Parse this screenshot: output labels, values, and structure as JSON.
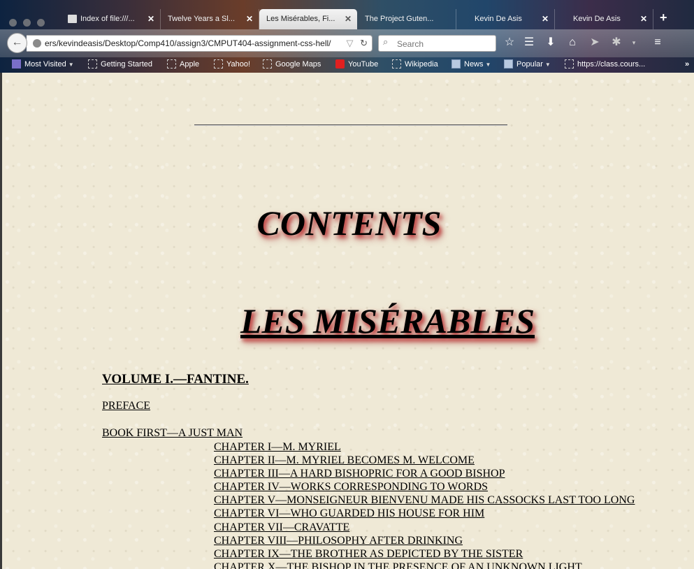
{
  "browser": {
    "tabs": [
      {
        "title": "Index of file:///...",
        "active": false
      },
      {
        "title": "Twelve Years a Sl...",
        "active": false
      },
      {
        "title": "Les Misérables, Fi...",
        "active": true
      },
      {
        "title": "The Project Guten...",
        "active": false
      },
      {
        "title": "Kevin De Asis",
        "active": false
      },
      {
        "title": "Kevin De Asis",
        "active": false
      }
    ],
    "url": "ers/kevindeasis/Desktop/Comp410/assign3/CMPUT404-assignment-css-hell/",
    "search_placeholder": "Search",
    "bookmarks": [
      "Most Visited",
      "Getting Started",
      "Apple",
      "Yahoo!",
      "Google Maps",
      "YouTube",
      "Wikipedia",
      "News",
      "Popular",
      "https://class.cours..."
    ]
  },
  "page": {
    "heading": "CONTENTS",
    "title": "LES MISÉRABLES",
    "volume": "VOLUME I.—FANTINE.",
    "preface": "PREFACE",
    "book": "BOOK FIRST—A JUST MAN",
    "chapters": [
      "CHAPTER I—M. MYRIEL",
      "CHAPTER II—M. MYRIEL BECOMES M. WELCOME",
      "CHAPTER III—A HARD BISHOPRIC FOR A GOOD BISHOP",
      "CHAPTER IV—WORKS CORRESPONDING TO WORDS",
      "CHAPTER V—MONSEIGNEUR BIENVENU MADE HIS CASSOCKS LAST TOO LONG",
      "CHAPTER VI—WHO GUARDED HIS HOUSE FOR HIM",
      "CHAPTER VII—CRAVATTE",
      "CHAPTER VIII—PHILOSOPHY AFTER DRINKING",
      "CHAPTER IX—THE BROTHER AS DEPICTED BY THE SISTER",
      "CHAPTER X—THE BISHOP IN THE PRESENCE OF AN UNKNOWN LIGHT"
    ]
  },
  "colors": {
    "page_background": "#efe9d6",
    "text_shadow": "#c04040"
  }
}
